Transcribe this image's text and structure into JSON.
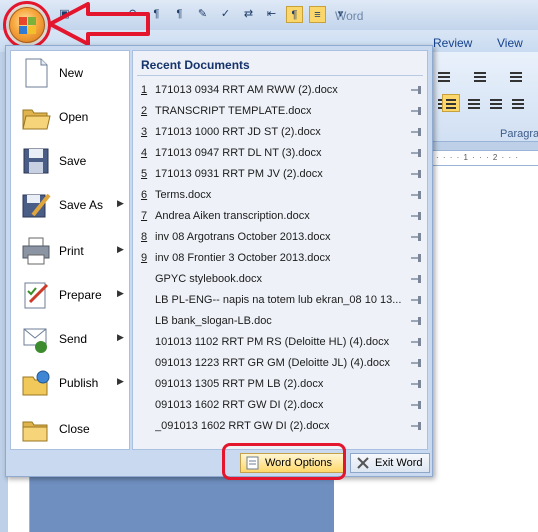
{
  "ribbon": {
    "tabs": [
      "Review",
      "View"
    ],
    "group_label": "Paragra",
    "window_title": "Word"
  },
  "menu": {
    "items": [
      {
        "label": "New",
        "icon": "new-document-icon",
        "has_arrow": false
      },
      {
        "label": "Open",
        "icon": "open-folder-icon",
        "has_arrow": false
      },
      {
        "label": "Save",
        "icon": "save-disk-icon",
        "has_arrow": false
      },
      {
        "label": "Save As",
        "icon": "save-as-icon",
        "has_arrow": true
      },
      {
        "label": "Print",
        "icon": "printer-icon",
        "has_arrow": true
      },
      {
        "label": "Prepare",
        "icon": "prepare-icon",
        "has_arrow": true
      },
      {
        "label": "Send",
        "icon": "send-icon",
        "has_arrow": true
      },
      {
        "label": "Publish",
        "icon": "publish-icon",
        "has_arrow": true
      },
      {
        "label": "Close",
        "icon": "close-folder-icon",
        "has_arrow": false
      }
    ],
    "recent_header": "Recent Documents",
    "recent": [
      {
        "num": "1",
        "name": "171013 0934 RRT AM RWW (2).docx"
      },
      {
        "num": "2",
        "name": "TRANSCRIPT TEMPLATE.docx"
      },
      {
        "num": "3",
        "name": "171013 1000 RRT JD ST (2).docx"
      },
      {
        "num": "4",
        "name": "171013 0947 RRT DL NT (3).docx"
      },
      {
        "num": "5",
        "name": "171013 0931 RRT PM JV (2).docx"
      },
      {
        "num": "6",
        "name": "Terms.docx"
      },
      {
        "num": "7",
        "name": "Andrea Aiken transcription.docx"
      },
      {
        "num": "8",
        "name": "inv 08 Argotrans October 2013.docx"
      },
      {
        "num": "9",
        "name": "inv 08 Frontier 3 October 2013.docx"
      },
      {
        "num": "",
        "name": "GPYC stylebook.docx"
      },
      {
        "num": "",
        "name": "LB PL-ENG-- napis na totem lub ekran_08 10 13..."
      },
      {
        "num": "",
        "name": "LB bank_slogan-LB.doc"
      },
      {
        "num": "",
        "name": "101013 1102 RRT PM RS (Deloitte HL) (4).docx"
      },
      {
        "num": "",
        "name": "091013 1223 RRT GR GM (Deloitte JL) (4).docx"
      },
      {
        "num": "",
        "name": "091013 1305 RRT PM LB (2).docx"
      },
      {
        "num": "",
        "name": "091013 1602 RRT GW DI (2).docx"
      },
      {
        "num": "",
        "name": "_091013 1602 RRT GW DI (2).docx"
      }
    ],
    "word_options_label": "Word Options",
    "exit_word_label": "Exit Word"
  },
  "colors": {
    "highlight_red": "#e3162d",
    "office_orange": "#f7a73d",
    "menu_blue": "#c9d9ef"
  }
}
